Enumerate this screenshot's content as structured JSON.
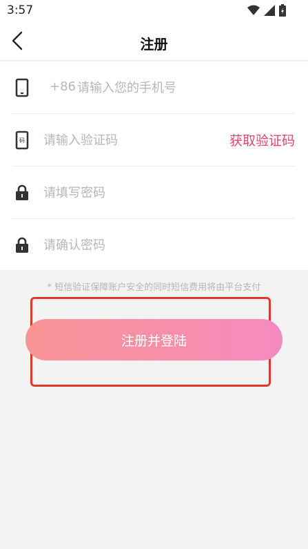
{
  "status_bar": {
    "time": "3:57",
    "icons": [
      "wifi-icon",
      "signal-icon",
      "battery-icon"
    ]
  },
  "header": {
    "title": "注册",
    "back_icon": "chevron-left-icon"
  },
  "form": {
    "phone": {
      "prefix": "+86",
      "placeholder": "请输入您的手机号",
      "icon": "phone-icon"
    },
    "code": {
      "placeholder": "请输入验证码",
      "icon": "sms-code-icon",
      "get_code_label": "获取验证码"
    },
    "password": {
      "placeholder": "请填写密码",
      "icon": "lock-icon"
    },
    "confirm_password": {
      "placeholder": "请确认密码",
      "icon": "lock-icon"
    }
  },
  "notice": "* 短信验证保障账户安全的同时短信费用将由平台支付",
  "submit_label": "注册并登陆",
  "colors": {
    "accent": "#e8436a",
    "button_gradient_start": "#f99496",
    "button_gradient_end": "#f58ac1",
    "highlight_border": "#e0392c",
    "background": "#f3f3f3"
  }
}
